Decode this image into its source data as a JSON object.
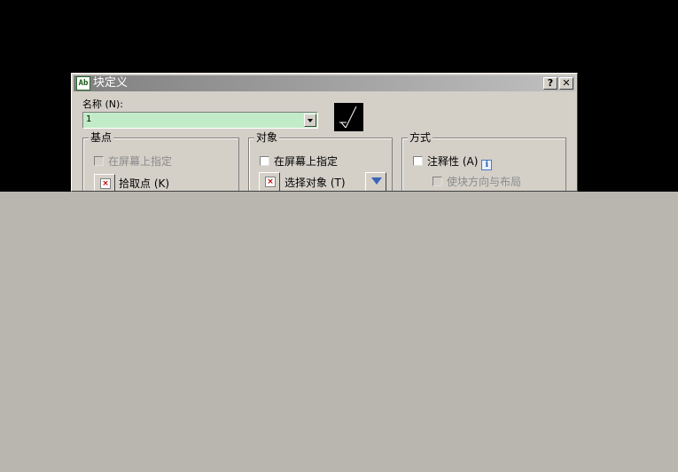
{
  "dialog": {
    "title": "块定义",
    "app_icon": "Ab",
    "help_button": "?",
    "close_button": "✕"
  },
  "name": {
    "label": "名称 (N):",
    "value": "1"
  },
  "base_point": {
    "title": "基点",
    "specify_on_screen": "在屏幕上指定",
    "pick_point": "拾取点 (K)"
  },
  "objects": {
    "title": "对象",
    "specify_on_screen": "在屏幕上指定",
    "select_objects": "选择对象 (T)"
  },
  "behavior": {
    "title": "方式",
    "annotative": "注释性 (A)",
    "match_orientation": "使块方向与布局"
  },
  "colors": {
    "background": "#000000",
    "dialog": "#d4d0c8",
    "name_field": "#c2ecc8",
    "covered_area": "#b8b6ae"
  }
}
